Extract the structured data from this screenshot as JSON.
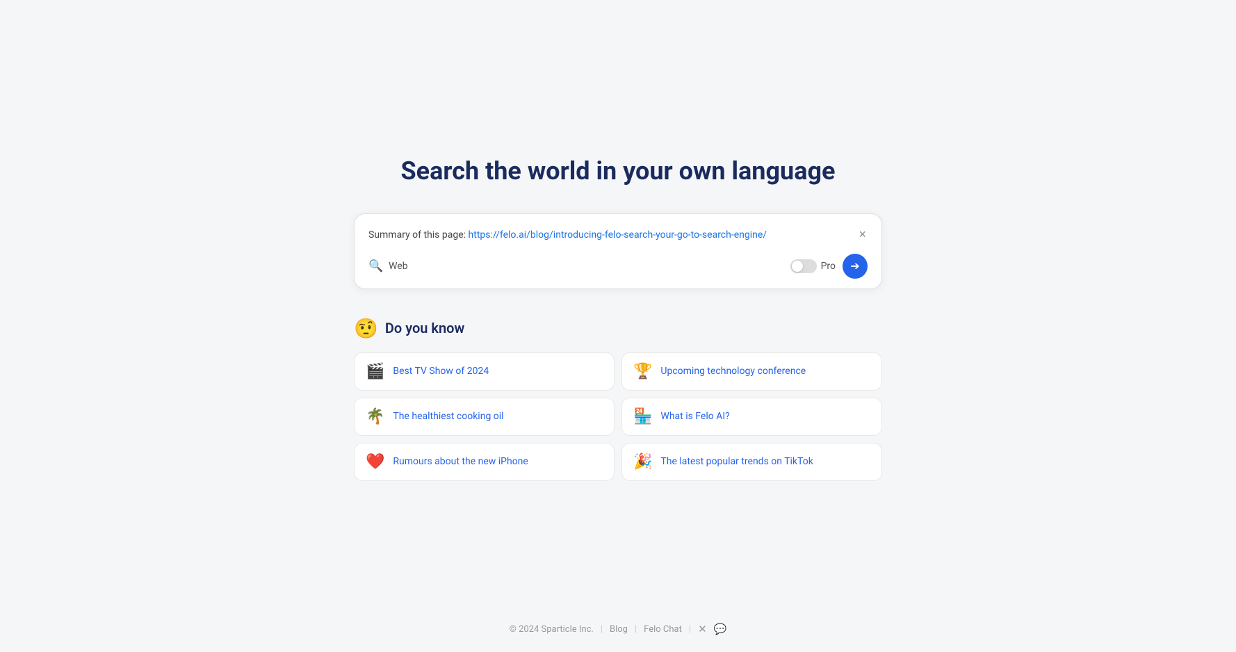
{
  "hero": {
    "title": "Search the world in your own language"
  },
  "search_box": {
    "summary_prefix": "Summary of this page:",
    "url": "https://felo.ai/blog/introducing-felo-search-your-go-to-search-engine/",
    "web_label": "Web",
    "pro_label": "Pro",
    "close_label": "×",
    "submit_arrow": "→"
  },
  "do_you_know": {
    "emoji": "🤨",
    "title": "Do you know",
    "suggestions": [
      {
        "icon": "🎬",
        "text": "Best TV Show of 2024"
      },
      {
        "icon": "🏆",
        "text": "Upcoming technology conference"
      },
      {
        "icon": "🌴",
        "text": "The healthiest cooking oil"
      },
      {
        "icon": "🏪",
        "text": "What is Felo AI?"
      },
      {
        "icon": "❤️",
        "text": "Rumours about the new iPhone"
      },
      {
        "icon": "🎉",
        "text": "The latest popular trends on TikTok"
      }
    ]
  },
  "footer": {
    "copyright": "© 2024 Sparticle Inc.",
    "links": [
      "Blog",
      "Felo Chat"
    ],
    "separator": "|"
  }
}
